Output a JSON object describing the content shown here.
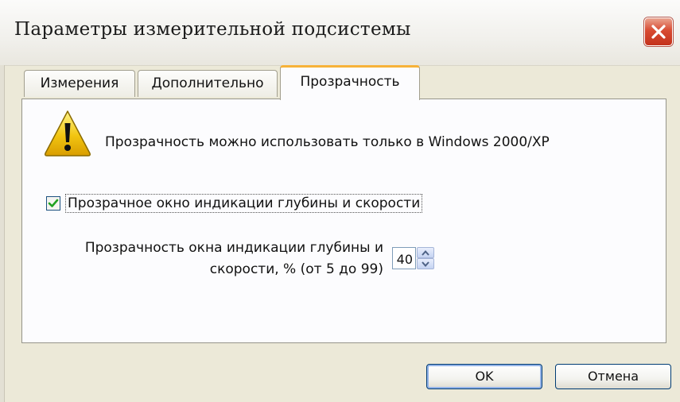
{
  "window": {
    "title": "Параметры измерительной подсистемы"
  },
  "tabs": [
    {
      "label": "Измерения",
      "active": false
    },
    {
      "label": "Дополнительно",
      "active": false
    },
    {
      "label": "Прозрачность",
      "active": true
    }
  ],
  "panel": {
    "warning": {
      "icon": "warning-icon",
      "text": "Прозрачность можно использовать только в Windows 2000/XP"
    },
    "checkbox": {
      "label": "Прозрачное окно индикации глубины и скорости",
      "checked": true
    },
    "opacity": {
      "label_line1": "Прозрачность окна индикации глубины и",
      "label_line2": "скорости, % (от 5 до 99)",
      "value": "40"
    }
  },
  "buttons": {
    "ok": "OK",
    "cancel": "Отмена"
  },
  "colors": {
    "active_tab_accent": "#f7b238",
    "close_button": "#d84b32",
    "warning_yellow": "#f2c511"
  }
}
